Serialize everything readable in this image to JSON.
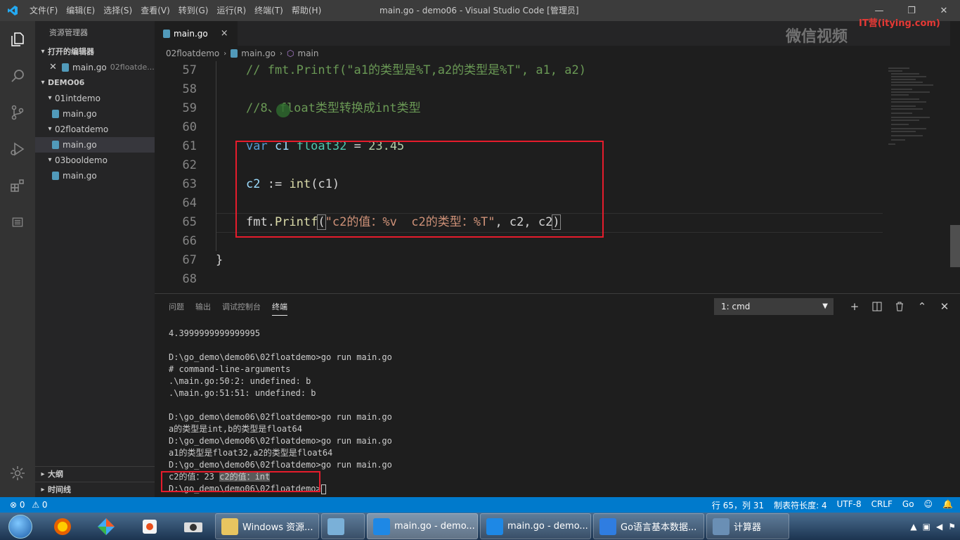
{
  "window": {
    "title": "main.go - demo06 - Visual Studio Code [管理员]",
    "menu": [
      "文件(F)",
      "编辑(E)",
      "选择(S)",
      "查看(V)",
      "转到(G)",
      "运行(R)",
      "终端(T)",
      "帮助(H)"
    ],
    "controls": {
      "minimize": "—",
      "maximize": "❐",
      "close": "✕"
    }
  },
  "sidebar": {
    "title": "资源管理器",
    "open_editors_label": "打开的编辑器",
    "open_editor_file": "main.go",
    "open_editor_path": "02floatde...",
    "workspace_label": "DEMO06",
    "tree": [
      {
        "folder": "01intdemo",
        "file": "main.go"
      },
      {
        "folder": "02floatdemo",
        "file": "main.go"
      },
      {
        "folder": "03booldemo",
        "file": "main.go"
      }
    ],
    "outline_label": "大纲",
    "timeline_label": "时间线"
  },
  "tab": {
    "label": "main.go",
    "close": "×"
  },
  "breadcrumb": {
    "folder": "02floatdemo",
    "file": "main.go",
    "symbol": "main"
  },
  "editor": {
    "lines": [
      {
        "n": "57"
      },
      {
        "n": "58"
      },
      {
        "n": "59"
      },
      {
        "n": "60"
      },
      {
        "n": "61"
      },
      {
        "n": "62"
      },
      {
        "n": "63"
      },
      {
        "n": "64"
      },
      {
        "n": "65"
      },
      {
        "n": "66"
      },
      {
        "n": "67"
      },
      {
        "n": "68"
      }
    ],
    "l57": "// fmt.Printf(\"a1的类型是%T,a2的类型是%T\", a1, a2)",
    "l59": "//8、float类型转换成int类型",
    "l61_kw": "var",
    "l61_var": "c1",
    "l61_type": "float32",
    "l61_eq": "=",
    "l61_num": "23.45",
    "l63_var": "c2",
    "l63_op": ":=",
    "l63_fn": "int",
    "l63_args": "(c1)",
    "l65_pkg": "fmt.",
    "l65_fn": "Printf",
    "l65_open": "(",
    "l65_str": "\"c2的值：%v  c2的类型：%T\"",
    "l65_args": ", c2, c2",
    "l65_close": ")",
    "l67": "}"
  },
  "watermark": {
    "text": "微信视频",
    "brand": "IT营(itying.com)"
  },
  "panel": {
    "tabs": [
      "问题",
      "输出",
      "调试控制台",
      "终端"
    ],
    "active_tab": "终端",
    "terminal_select": "1: cmd",
    "controls": {
      "new": "+",
      "split": "⧉",
      "kill": "🗑",
      "maximize": "⌃",
      "close": "✕"
    },
    "terminal_lines": [
      "4.3999999999999995",
      "",
      "D:\\go_demo\\demo06\\02floatdemo>go run main.go",
      "# command-line-arguments",
      ".\\main.go:50:2: undefined: b",
      ".\\main.go:51:51: undefined: b",
      "",
      "D:\\go_demo\\demo06\\02floatdemo>go run main.go",
      "a的类型是int,b的类型是float64",
      "D:\\go_demo\\demo06\\02floatdemo>go run main.go",
      "a1的类型是float32,a2的类型是float64",
      "D:\\go_demo\\demo06\\02floatdemo>go run main.go"
    ],
    "result_value": "c2的值：23 ",
    "result_type": "c2的值：int",
    "prompt": "D:\\go_demo\\demo06\\02floatdemo>"
  },
  "statusbar": {
    "errors": "⊗ 0",
    "warnings": "⚠ 0",
    "position": "行 65，列 31",
    "tab_size": "制表符长度: 4",
    "encoding": "UTF-8",
    "eol": "CRLF",
    "language": "Go"
  },
  "taskbar": {
    "buttons": [
      {
        "label": "Windows 资源...",
        "color": "#e8c560"
      },
      {
        "label": "",
        "color": "#7ab0d8"
      },
      {
        "label": "main.go - demo...",
        "color": "#1e88e5"
      },
      {
        "label": "main.go - demo...",
        "color": "#1e88e5"
      },
      {
        "label": "Go语言基本数据...",
        "color": "#2f7de1"
      },
      {
        "label": "计算器",
        "color": "#6a8fb5"
      }
    ]
  }
}
